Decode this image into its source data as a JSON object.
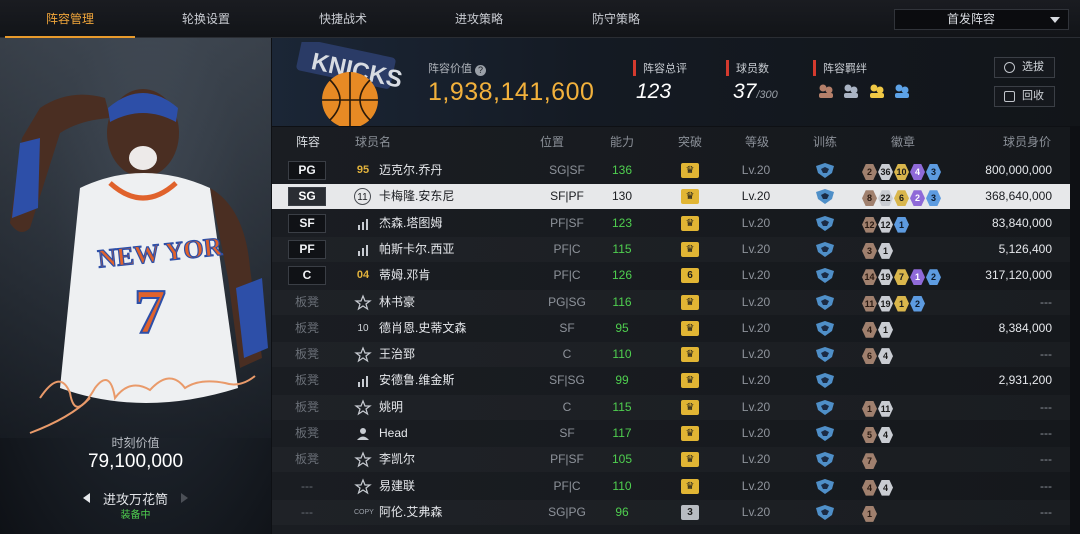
{
  "tabs": [
    {
      "label": "阵容管理",
      "active": true
    },
    {
      "label": "轮换设置",
      "active": false
    },
    {
      "label": "快捷战术",
      "active": false
    },
    {
      "label": "进攻策略",
      "active": false
    },
    {
      "label": "防守策略",
      "active": false
    }
  ],
  "lineup_select": {
    "value": "首发阵容"
  },
  "player_card": {
    "value_label": "时刻价值",
    "value": "79,100,000",
    "skill": "进攻万花筒",
    "equipped": "装备中"
  },
  "team": {
    "value_label": "阵容价值",
    "total_value": "1,938,141,600",
    "rating_label": "阵容总评",
    "rating": "123",
    "count_label": "球员数",
    "count": "37",
    "count_max": "/300",
    "bond_label": "阵容羁绊",
    "scout_label": "选拔",
    "recycle_label": "回收",
    "colors": {
      "accent": "#f2b13c",
      "red_marker": "#d43a2e",
      "green": "#4fcf4f"
    }
  },
  "table": {
    "headers": [
      "阵容",
      "球员名",
      "位置",
      "能力",
      "突破",
      "等级",
      "训练",
      "徽章",
      "球员身价"
    ],
    "rows": [
      {
        "slot": "PG",
        "starter": true,
        "jersey": "95",
        "jersey_style": "gold",
        "name": "迈克尔.乔丹",
        "position": "SG|SF",
        "ability": "136",
        "break": "crown",
        "level": "Lv.20",
        "medals": [
          [
            "m-bronze",
            "2"
          ],
          [
            "m-silver",
            "36"
          ],
          [
            "m-gold",
            "10"
          ],
          [
            "m-purple",
            "4"
          ],
          [
            "m-blue",
            "3"
          ]
        ],
        "value": "800,000,000"
      },
      {
        "slot": "SG",
        "starter": true,
        "selected": true,
        "jersey": "11",
        "jersey_style": "circle",
        "name": "卡梅隆.安东尼",
        "position": "SF|PF",
        "ability": "130",
        "break": "crown",
        "level": "Lv.20",
        "medals": [
          [
            "m-bronze",
            "8"
          ],
          [
            "m-silver",
            "22"
          ],
          [
            "m-gold",
            "6"
          ],
          [
            "m-purple",
            "2"
          ],
          [
            "m-blue",
            "3"
          ]
        ],
        "value": "368,640,000"
      },
      {
        "slot": "SF",
        "starter": true,
        "jersey": "bars",
        "name": "杰森.塔图姆",
        "position": "PF|SF",
        "ability": "123",
        "break": "crown",
        "level": "Lv.20",
        "medals": [
          [
            "m-bronze",
            "12"
          ],
          [
            "m-silver",
            "12"
          ],
          [
            "m-blue",
            "1"
          ]
        ],
        "value": "83,840,000"
      },
      {
        "slot": "PF",
        "starter": true,
        "jersey": "bars",
        "name": "帕斯卡尔.西亚",
        "position": "PF|C",
        "ability": "115",
        "break": "crown",
        "level": "Lv.20",
        "medals": [
          [
            "m-bronze",
            "3"
          ],
          [
            "m-silver",
            "1"
          ]
        ],
        "value": "5,126,400"
      },
      {
        "slot": "C",
        "starter": true,
        "jersey": "04",
        "jersey_style": "gold",
        "name": "蒂姆.邓肯",
        "position": "PF|C",
        "ability": "126",
        "break": "6",
        "level": "Lv.20",
        "medals": [
          [
            "m-bronze",
            "14"
          ],
          [
            "m-silver",
            "19"
          ],
          [
            "m-gold",
            "7"
          ],
          [
            "m-purple",
            "1"
          ],
          [
            "m-blue",
            "2"
          ]
        ],
        "value": "317,120,000"
      },
      {
        "slot": "板凳",
        "starter": false,
        "jersey": "star",
        "name": "林书豪",
        "position": "PG|SG",
        "ability": "116",
        "break": "crown",
        "level": "Lv.20",
        "medals": [
          [
            "m-bronze",
            "11"
          ],
          [
            "m-silver",
            "19"
          ],
          [
            "m-gold",
            "1"
          ],
          [
            "m-blue",
            "2"
          ]
        ],
        "value": "---"
      },
      {
        "slot": "板凳",
        "starter": false,
        "jersey": "10",
        "jersey_style": "plain",
        "name": "德肖恩.史蒂文森",
        "position": "SF",
        "ability": "95",
        "break": "crown",
        "level": "Lv.20",
        "medals": [
          [
            "m-bronze",
            "4"
          ],
          [
            "m-silver",
            "1"
          ]
        ],
        "value": "8,384,000"
      },
      {
        "slot": "板凳",
        "starter": false,
        "jersey": "star",
        "name": "王治郅",
        "position": "C",
        "ability": "110",
        "break": "crown",
        "level": "Lv.20",
        "medals": [
          [
            "m-bronze",
            "6"
          ],
          [
            "m-silver",
            "4"
          ]
        ],
        "value": "---"
      },
      {
        "slot": "板凳",
        "starter": false,
        "jersey": "bars",
        "name": "安德鲁.维金斯",
        "position": "SF|SG",
        "ability": "99",
        "break": "crown",
        "level": "Lv.20",
        "medals": [],
        "value": "2,931,200"
      },
      {
        "slot": "板凳",
        "starter": false,
        "jersey": "star",
        "name": "姚明",
        "position": "C",
        "ability": "115",
        "break": "crown",
        "level": "Lv.20",
        "medals": [
          [
            "m-bronze",
            "1"
          ],
          [
            "m-silver",
            "11"
          ]
        ],
        "value": "---"
      },
      {
        "slot": "板凳",
        "starter": false,
        "jersey": "person",
        "name": "Head",
        "position": "SF",
        "ability": "117",
        "break": "crown",
        "level": "Lv.20",
        "medals": [
          [
            "m-bronze",
            "5"
          ],
          [
            "m-silver",
            "4"
          ]
        ],
        "value": "---"
      },
      {
        "slot": "板凳",
        "starter": false,
        "jersey": "star",
        "name": "李凯尔",
        "position": "PF|SF",
        "ability": "105",
        "break": "crown",
        "level": "Lv.20",
        "medals": [
          [
            "m-bronze",
            "7"
          ]
        ],
        "value": "---"
      },
      {
        "slot": "---",
        "starter": false,
        "jersey": "star",
        "name": "易建联",
        "position": "PF|C",
        "ability": "110",
        "break": "crown",
        "level": "Lv.20",
        "medals": [
          [
            "m-bronze",
            "4"
          ],
          [
            "m-silver",
            "4"
          ]
        ],
        "value": "---"
      },
      {
        "slot": "---",
        "starter": false,
        "jersey": "COPY",
        "jersey_style": "copy",
        "name": "阿伦.艾弗森",
        "position": "SG|PG",
        "ability": "96",
        "break": "3",
        "break_style": "gray",
        "level": "Lv.20",
        "medals": [
          [
            "m-bronze",
            "1"
          ]
        ],
        "value": "---"
      }
    ]
  }
}
